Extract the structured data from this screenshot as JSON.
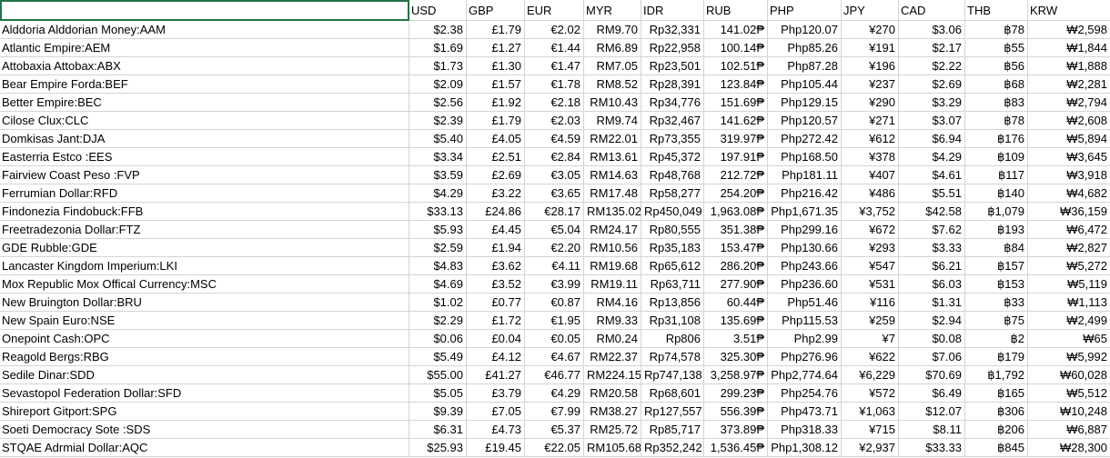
{
  "columns": [
    "",
    "USD",
    "GBP",
    "EUR",
    "MYR",
    "IDR",
    "RUB",
    "PHP",
    "JPY",
    "CAD",
    "THB",
    "KRW"
  ],
  "rows": [
    [
      "Alddoria Alddorian Money:AAM",
      "$2.38",
      "£1.79",
      "€2.02",
      "RM9.70",
      "Rp32,331",
      "141.02₱",
      "Php120.07",
      "¥270",
      "$3.06",
      "฿78",
      "₩2,598"
    ],
    [
      "Atlantic Empire:AEM",
      "$1.69",
      "£1.27",
      "€1.44",
      "RM6.89",
      "Rp22,958",
      "100.14₱",
      "Php85.26",
      "¥191",
      "$2.17",
      "฿55",
      "₩1,844"
    ],
    [
      "Attobaxia Attobax:ABX",
      "$1.73",
      "£1.30",
      "€1.47",
      "RM7.05",
      "Rp23,501",
      "102.51₱",
      "Php87.28",
      "¥196",
      "$2.22",
      "฿56",
      "₩1,888"
    ],
    [
      "Bear Empire Forda:BEF",
      "$2.09",
      "£1.57",
      "€1.78",
      "RM8.52",
      "Rp28,391",
      "123.84₱",
      "Php105.44",
      "¥237",
      "$2.69",
      "฿68",
      "₩2,281"
    ],
    [
      "Better Empire:BEC",
      "$2.56",
      "£1.92",
      "€2.18",
      "RM10.43",
      "Rp34,776",
      "151.69₱",
      "Php129.15",
      "¥290",
      "$3.29",
      "฿83",
      "₩2,794"
    ],
    [
      "Cilose Clux:CLC",
      "$2.39",
      "£1.79",
      "€2.03",
      "RM9.74",
      "Rp32,467",
      "141.62₱",
      "Php120.57",
      "¥271",
      "$3.07",
      "฿78",
      "₩2,608"
    ],
    [
      "Domkisas Jant:DJA",
      "$5.40",
      "£4.05",
      "€4.59",
      "RM22.01",
      "Rp73,355",
      "319.97₱",
      "Php272.42",
      "¥612",
      "$6.94",
      "฿176",
      "₩5,894"
    ],
    [
      "Easterria Estco :EES",
      "$3.34",
      "£2.51",
      "€2.84",
      "RM13.61",
      "Rp45,372",
      "197.91₱",
      "Php168.50",
      "¥378",
      "$4.29",
      "฿109",
      "₩3,645"
    ],
    [
      "Fairview Coast Peso :FVP",
      "$3.59",
      "£2.69",
      "€3.05",
      "RM14.63",
      "Rp48,768",
      "212.72₱",
      "Php181.11",
      "¥407",
      "$4.61",
      "฿117",
      "₩3,918"
    ],
    [
      "Ferrumian Dollar:RFD",
      "$4.29",
      "£3.22",
      "€3.65",
      "RM17.48",
      "Rp58,277",
      "254.20₱",
      "Php216.42",
      "¥486",
      "$5.51",
      "฿140",
      "₩4,682"
    ],
    [
      "Findonezia Findobuck:FFB",
      "$33.13",
      "£24.86",
      "€28.17",
      "RM135.02",
      "Rp450,049",
      "1,963.08₱",
      "Php1,671.35",
      "¥3,752",
      "$42.58",
      "฿1,079",
      "₩36,159"
    ],
    [
      "Freetradezonia Dollar:FTZ",
      "$5.93",
      "£4.45",
      "€5.04",
      "RM24.17",
      "Rp80,555",
      "351.38₱",
      "Php299.16",
      "¥672",
      "$7.62",
      "฿193",
      "₩6,472"
    ],
    [
      "GDE Rubble:GDE",
      "$2.59",
      "£1.94",
      "€2.20",
      "RM10.56",
      "Rp35,183",
      "153.47₱",
      "Php130.66",
      "¥293",
      "$3.33",
      "฿84",
      "₩2,827"
    ],
    [
      "Lancaster Kingdom Imperium:LKI",
      "$4.83",
      "£3.62",
      "€4.11",
      "RM19.68",
      "Rp65,612",
      "286.20₱",
      "Php243.66",
      "¥547",
      "$6.21",
      "฿157",
      "₩5,272"
    ],
    [
      "Mox Republic Mox Offical Currency:MSC",
      "$4.69",
      "£3.52",
      "€3.99",
      "RM19.11",
      "Rp63,711",
      "277.90₱",
      "Php236.60",
      "¥531",
      "$6.03",
      "฿153",
      "₩5,119"
    ],
    [
      "New Bruington Dollar:BRU",
      "$1.02",
      "£0.77",
      "€0.87",
      "RM4.16",
      "Rp13,856",
      "60.44₱",
      "Php51.46",
      "¥116",
      "$1.31",
      "฿33",
      "₩1,113"
    ],
    [
      "New Spain Euro:NSE",
      "$2.29",
      "£1.72",
      "€1.95",
      "RM9.33",
      "Rp31,108",
      "135.69₱",
      "Php115.53",
      "¥259",
      "$2.94",
      "฿75",
      "₩2,499"
    ],
    [
      "Onepoint Cash:OPC",
      "$0.06",
      "£0.04",
      "€0.05",
      "RM0.24",
      "Rp806",
      "3.51₱",
      "Php2.99",
      "¥7",
      "$0.08",
      "฿2",
      "₩65"
    ],
    [
      "Reagold Bergs:RBG",
      "$5.49",
      "£4.12",
      "€4.67",
      "RM22.37",
      "Rp74,578",
      "325.30₱",
      "Php276.96",
      "¥622",
      "$7.06",
      "฿179",
      "₩5,992"
    ],
    [
      "Sedile Dinar:SDD",
      "$55.00",
      "£41.27",
      "€46.77",
      "RM224.15",
      "Rp747,138",
      "3,258.97₱",
      "Php2,774.64",
      "¥6,229",
      "$70.69",
      "฿1,792",
      "₩60,028"
    ],
    [
      "Sevastopol Federation Dollar:SFD",
      "$5.05",
      "£3.79",
      "€4.29",
      "RM20.58",
      "Rp68,601",
      "299.23₱",
      "Php254.76",
      "¥572",
      "$6.49",
      "฿165",
      "₩5,512"
    ],
    [
      "Shireport Gitport:SPG",
      "$9.39",
      "£7.05",
      "€7.99",
      "RM38.27",
      "Rp127,557",
      "556.39₱",
      "Php473.71",
      "¥1,063",
      "$12.07",
      "฿306",
      "₩10,248"
    ],
    [
      "Soeti Democracy Sote :SDS",
      "$6.31",
      "£4.73",
      "€5.37",
      "RM25.72",
      "Rp85,717",
      "373.89₱",
      "Php318.33",
      "¥715",
      "$8.11",
      "฿206",
      "₩6,887"
    ],
    [
      "STQAE Adrmial Dollar:AQC",
      "$25.93",
      "£19.45",
      "€22.05",
      "RM105.68",
      "Rp352,242",
      "1,536.45₱",
      "Php1,308.12",
      "¥2,937",
      "$33.33",
      "฿845",
      "₩28,300"
    ]
  ]
}
